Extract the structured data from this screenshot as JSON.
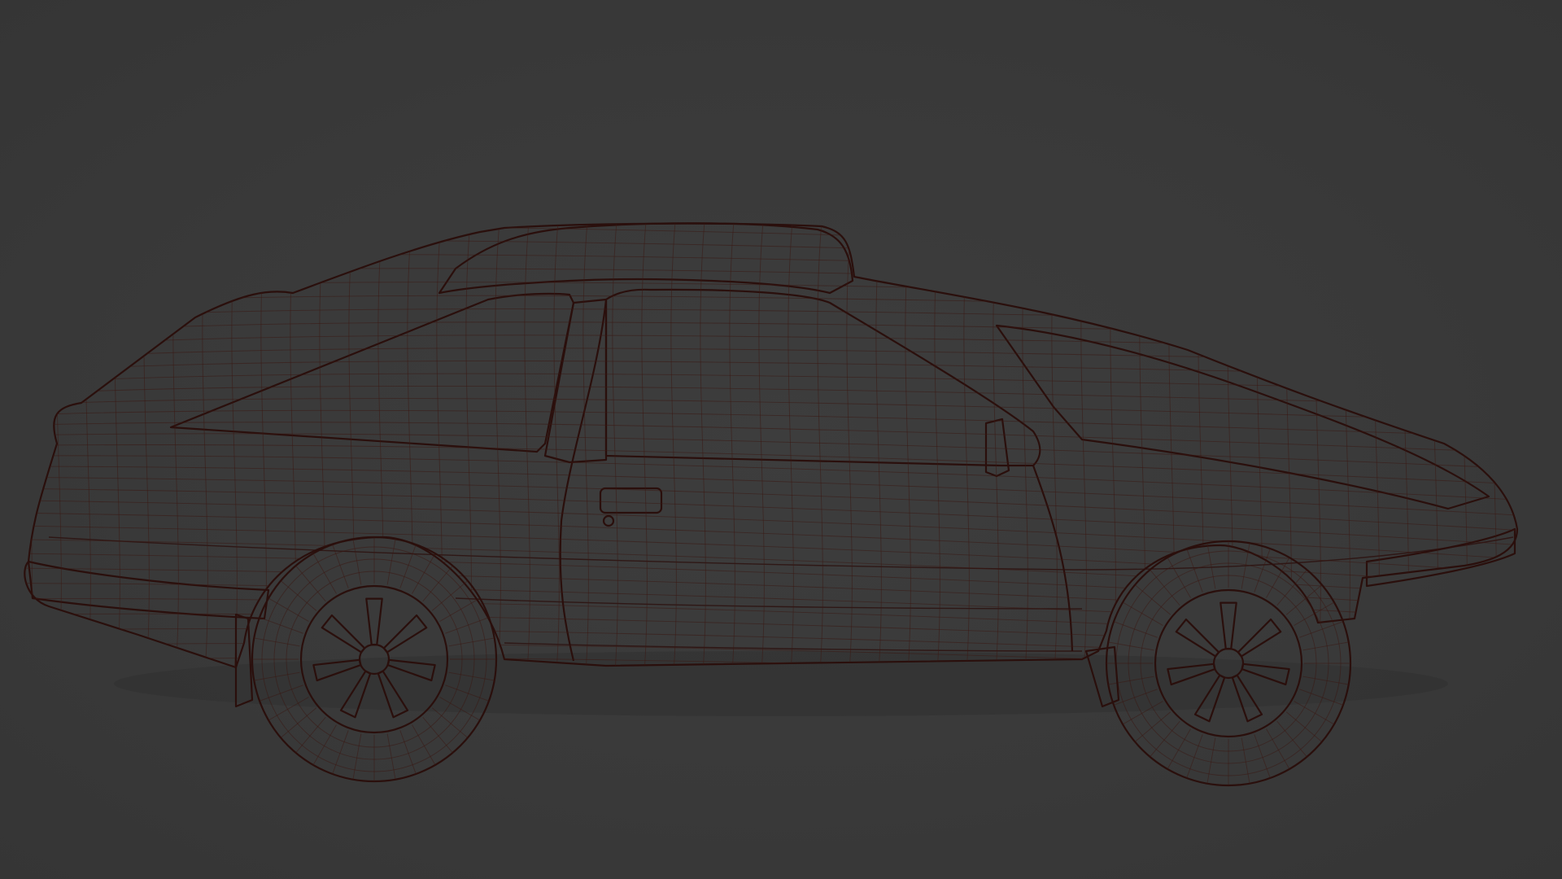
{
  "viewport": {
    "background_color": "#3a3a3a",
    "shading_mode": "wireframe-overlay",
    "model_icon": "car-icon"
  },
  "colors": {
    "body_base": "#a85a54",
    "body_highlight": "#b8726c",
    "body_shadow": "#7a3a33",
    "glass": "#a86a6a",
    "wire": "#3b1713",
    "edge": "#2a0f0c"
  },
  "model": {
    "wheels": 2,
    "spokes_per_wheel": 7
  }
}
